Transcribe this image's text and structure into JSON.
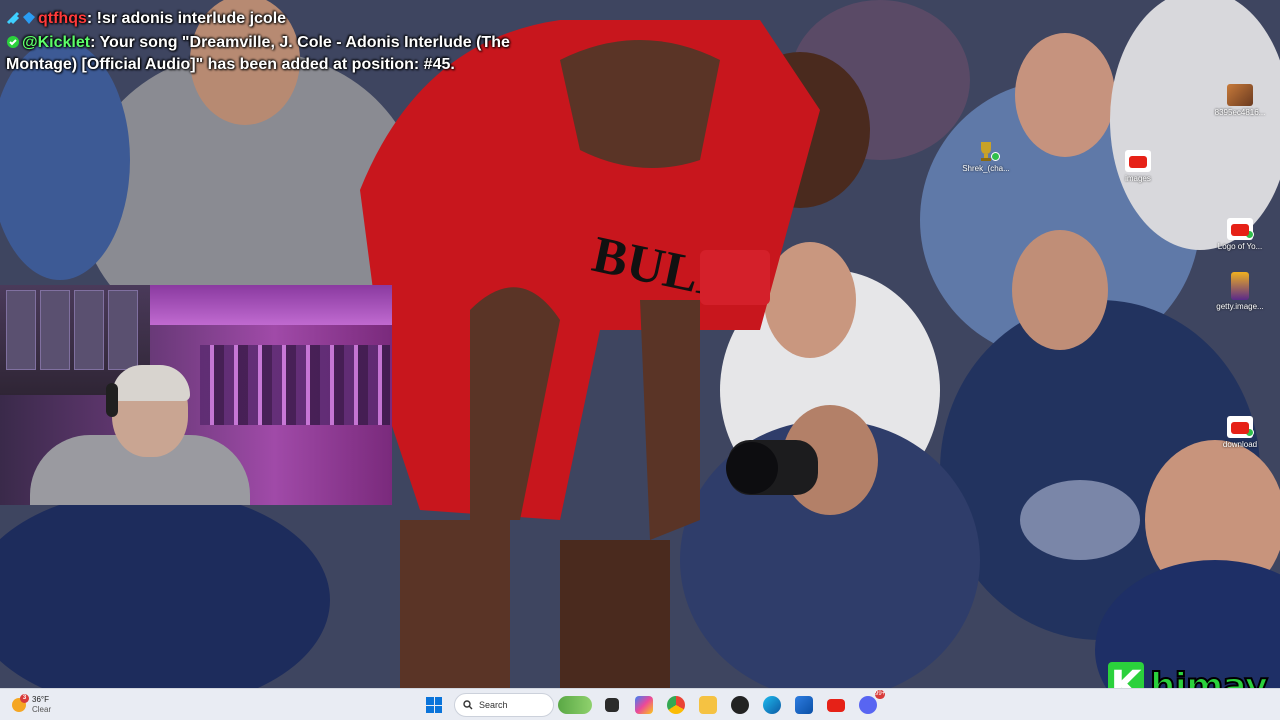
{
  "chat": {
    "messages": [
      {
        "user": "qtfhqs",
        "user_color": "#ff3b3b",
        "text": "!sr adonis interlude jcole"
      },
      {
        "user": "@Kicklet",
        "user_color": "#5cff6a",
        "text": "Your song \"Dreamville, J. Cole - Adonis Interlude (The Montage) [Official Audio]\" has been added at position: #45."
      }
    ]
  },
  "desktop_icons": [
    {
      "label": "8395ec4816...",
      "icon": "image-thumbnail-icon"
    },
    {
      "label": "Shrek_(cha...",
      "icon": "trophy-image-icon"
    },
    {
      "label": "images",
      "icon": "youtube-file-icon"
    },
    {
      "label": "Logo of Yo...",
      "icon": "youtube-file-icon"
    },
    {
      "label": "getty.image...",
      "icon": "image-thumbnail-icon"
    },
    {
      "label": "download",
      "icon": "youtube-file-icon"
    }
  ],
  "watermark": {
    "letter": "K",
    "text": "himay"
  },
  "taskbar": {
    "weather": {
      "temp": "36°F",
      "condition": "Clear",
      "alert_count": "3"
    },
    "search": {
      "placeholder": "Search"
    },
    "apps": [
      "file-explorer-icon",
      "copilot-icon",
      "chrome-icon",
      "folder-icon",
      "obs-icon",
      "edge-icon",
      "store-icon",
      "youtube-icon",
      "discord-icon"
    ],
    "discord_badge": "99+"
  },
  "colors": {
    "taskbar_bg": "#e9ecf3",
    "accent_green": "#2bd13c",
    "windows_blue": "#0a74da"
  }
}
